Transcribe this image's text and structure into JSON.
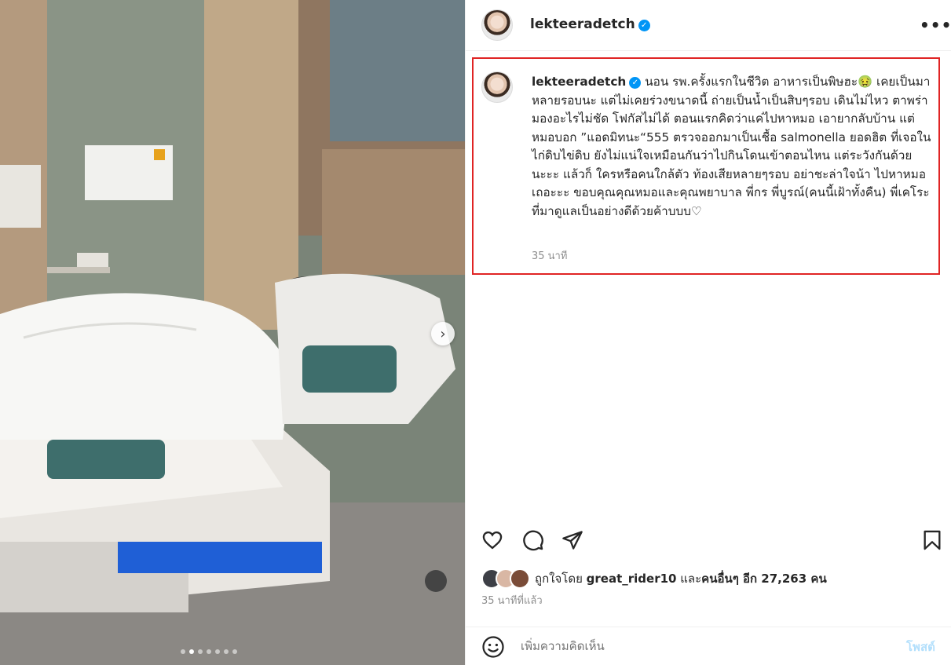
{
  "post": {
    "username": "lekteeradetch",
    "verified_glyph": "✓",
    "more_label": "•••"
  },
  "caption": {
    "username": "lekteeradetch",
    "text": "นอน รพ.ครั้งแรกในชีวิต อาหารเป็นพิษฮะ🤢 เคยเป็นมาหลายรอบนะ แต่ไม่เคยร่วงขนาดนี้ ถ่ายเป็นน้ำเป็นสิบๆรอบ เดินไม่ไหว ตาพร่า มองอะไรไม่ชัด โฟกัสไม่ได้ ตอนแรกคิดว่าแค่ไปหาหมอ เอายากลับบ้าน แต่หมอบอก ”แอดมิทนะ“555 ตรวจออกมาเป็นเชื้อ salmonella ยอดฮิต ที่เจอในไก่ดิบไข่ดิบ ยังไม่แน่ใจเหมือนกันว่าไปกินโดนเข้าตอนไหน แต่ระวังกันด้วยนะะะ แล้วก็ ใครหรือคนใกล้ตัว ท้องเสียหลายๆรอบ อย่าชะล่าใจน้า ไปหาหมอเถอะะะ ขอบคุณคุณหมอและคุณพยาบาล พี่กร พี่บูรณ์(คนนี้เฝ้าทั้งคืน) พี่เคโระที่มาดูแลเป็นอย่างดีด้วยค้าบบบ♡",
    "time": "35 นาที"
  },
  "likes": {
    "prefix": "ถูกใจโดย ",
    "user": "great_rider10",
    "middle": " และ",
    "others": "คนอื่นๆ อีก 27,263 คน"
  },
  "post_time": "35 นาทีที่แล้ว",
  "comment": {
    "placeholder": "เพิ่มความคิดเห็น",
    "post_label": "โพสต์"
  },
  "carousel": {
    "next_glyph": "›",
    "slide_count": 7,
    "active_index": 1
  },
  "icons": [
    "heart-icon",
    "comment-icon",
    "share-icon",
    "bookmark-icon",
    "emoji-icon",
    "more-icon",
    "verified-icon",
    "chevron-right-icon"
  ]
}
